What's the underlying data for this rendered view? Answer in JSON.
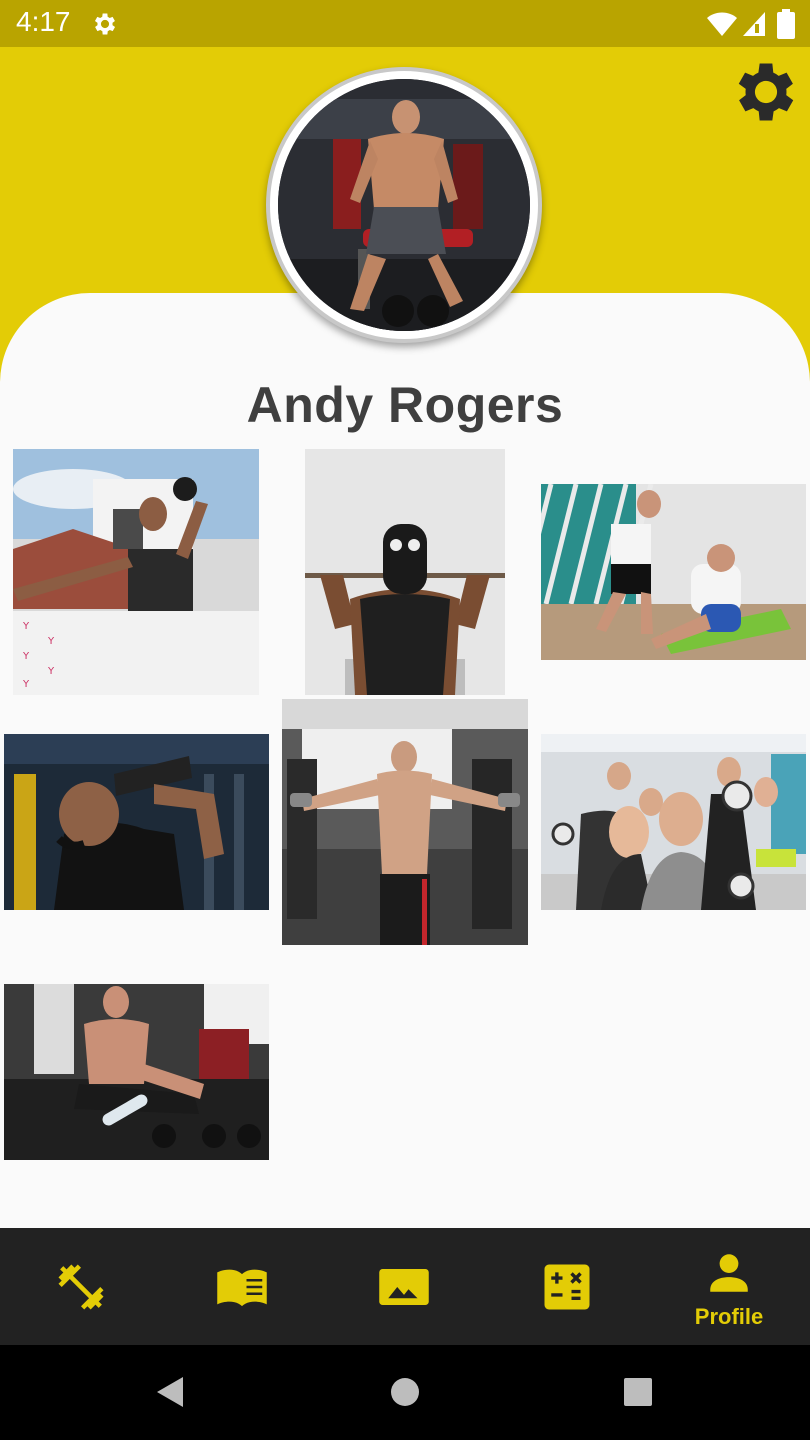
{
  "status_bar": {
    "time": "4:17",
    "icons": [
      "gear-icon",
      "wifi-icon",
      "signal-icon",
      "battery-icon"
    ]
  },
  "header": {
    "settings_icon": "gear-icon"
  },
  "profile": {
    "name": "Andy Rogers"
  },
  "gallery": {
    "photos": [
      {
        "name": "gallery-photo-kettlebell-press"
      },
      {
        "name": "gallery-photo-pull-up"
      },
      {
        "name": "gallery-photo-sit-up-training"
      },
      {
        "name": "gallery-photo-shaker-drink"
      },
      {
        "name": "gallery-photo-lateral-raise"
      },
      {
        "name": "gallery-photo-group-selfie"
      },
      {
        "name": "gallery-photo-floor-rest"
      }
    ]
  },
  "bottom_nav": {
    "items": [
      {
        "icon": "dumbbell-icon",
        "label": "",
        "active": false
      },
      {
        "icon": "book-icon",
        "label": "",
        "active": false
      },
      {
        "icon": "image-icon",
        "label": "",
        "active": false
      },
      {
        "icon": "calculator-icon",
        "label": "",
        "active": false
      },
      {
        "icon": "person-icon",
        "label": "Profile",
        "active": true
      }
    ],
    "accent_color": "#E3CC06",
    "background_color": "#222222"
  },
  "colors": {
    "brand_yellow": "#E3CC06",
    "status_bar": "#B9A400",
    "name_text": "#3F3F3F"
  },
  "system_nav": {
    "buttons": [
      "back-icon",
      "home-icon",
      "recents-icon"
    ]
  }
}
